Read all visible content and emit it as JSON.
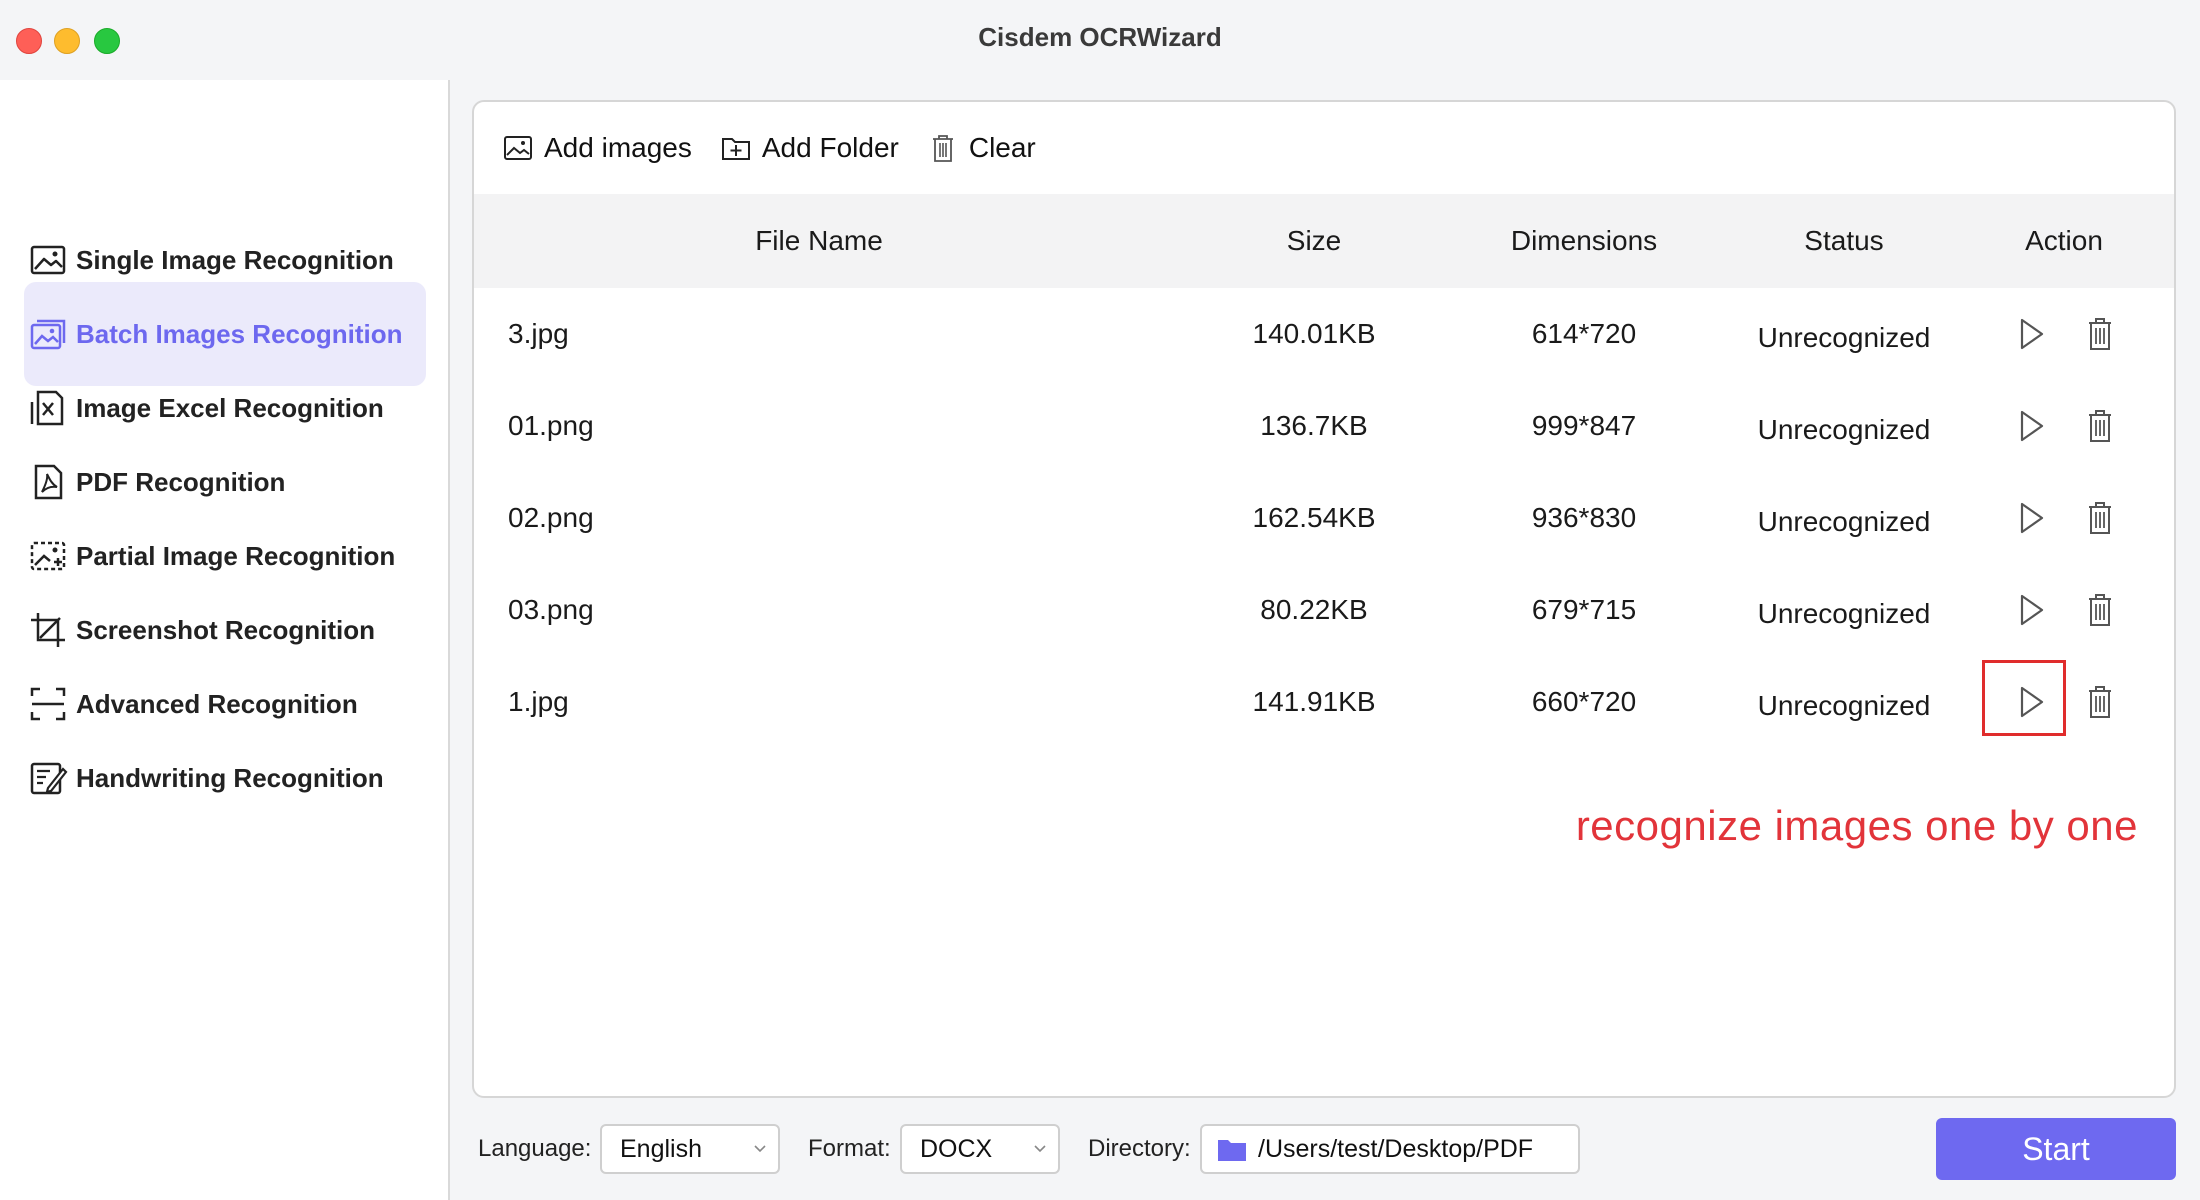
{
  "window": {
    "title": "Cisdem OCRWizard"
  },
  "sidebar": {
    "items": [
      {
        "label": "Single Image Recognition",
        "icon": "image-icon",
        "active": false
      },
      {
        "label": "Batch Images Recognition",
        "icon": "images-icon",
        "active": true
      },
      {
        "label": "Image Excel Recognition",
        "icon": "excel-icon",
        "active": false
      },
      {
        "label": "PDF Recognition",
        "icon": "pdf-icon",
        "active": false
      },
      {
        "label": "Partial Image Recognition",
        "icon": "partial-image-icon",
        "active": false
      },
      {
        "label": "Screenshot Recognition",
        "icon": "crop-icon",
        "active": false
      },
      {
        "label": "Advanced Recognition",
        "icon": "scan-frame-icon",
        "active": false
      },
      {
        "label": "Handwriting Recognition",
        "icon": "pen-edit-icon",
        "active": false
      }
    ]
  },
  "toolbar": {
    "add_images": "Add images",
    "add_folder": "Add Folder",
    "clear": "Clear"
  },
  "table": {
    "headers": {
      "file_name": "File Name",
      "size": "Size",
      "dimensions": "Dimensions",
      "status": "Status",
      "action": "Action"
    },
    "rows": [
      {
        "name": "3.jpg",
        "size": "140.01KB",
        "dimensions": "614*720",
        "status": "Unrecognized"
      },
      {
        "name": "01.png",
        "size": "136.7KB",
        "dimensions": "999*847",
        "status": "Unrecognized"
      },
      {
        "name": "02.png",
        "size": "162.54KB",
        "dimensions": "936*830",
        "status": "Unrecognized"
      },
      {
        "name": "03.png",
        "size": "80.22KB",
        "dimensions": "679*715",
        "status": "Unrecognized"
      },
      {
        "name": "1.jpg",
        "size": "141.91KB",
        "dimensions": "660*720",
        "status": "Unrecognized"
      }
    ]
  },
  "annotation": {
    "text": "recognize images one by one",
    "color": "#e2343a"
  },
  "bottom": {
    "language_label": "Language:",
    "language_value": "English",
    "format_label": "Format:",
    "format_value": "DOCX",
    "directory_label": "Directory:",
    "directory_value": "/Users/test/Desktop/PDF",
    "start_label": "Start"
  },
  "colors": {
    "accent": "#6e69f0",
    "active_bg": "#ebeafb",
    "highlight": "#e02c2c"
  }
}
